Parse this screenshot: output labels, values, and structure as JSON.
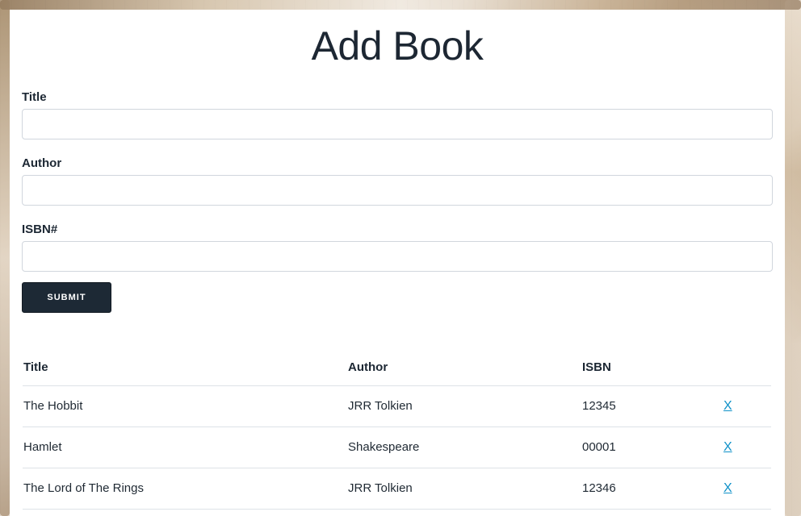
{
  "page": {
    "heading": "Add Book"
  },
  "form": {
    "title": {
      "label": "Title",
      "value": "",
      "placeholder": ""
    },
    "author": {
      "label": "Author",
      "value": "",
      "placeholder": ""
    },
    "isbn": {
      "label": "ISBN#",
      "value": "",
      "placeholder": ""
    },
    "submit_label": "Submit"
  },
  "table": {
    "headers": [
      "Title",
      "Author",
      "ISBN",
      ""
    ],
    "rows": [
      {
        "title": "The Hobbit",
        "author": "JRR Tolkien",
        "isbn": "12345",
        "delete_label": "X"
      },
      {
        "title": "Hamlet",
        "author": "Shakespeare",
        "isbn": "00001",
        "delete_label": "X"
      },
      {
        "title": "The Lord of The Rings",
        "author": "JRR Tolkien",
        "isbn": "12346",
        "delete_label": "X"
      }
    ]
  },
  "colors": {
    "text": "#1c2733",
    "button": "#1d2935",
    "link": "#0f91c8",
    "border": "#d1d6dd"
  }
}
